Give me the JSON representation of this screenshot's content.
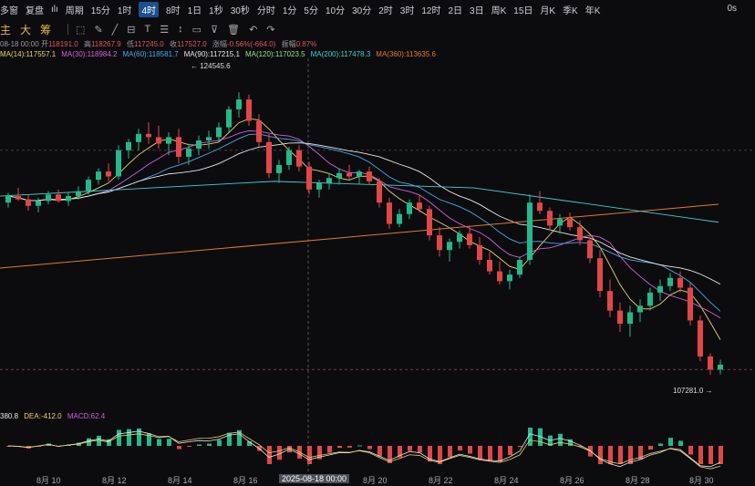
{
  "topbar": {
    "items": [
      "多窗",
      "复盘",
      "15分",
      "1时",
      "4时",
      "8时",
      "1日",
      "1秒",
      "30秒",
      "分时",
      "1分",
      "5分",
      "10分",
      "30分",
      "2时",
      "3时",
      "12时",
      "2日",
      "3日",
      "周K",
      "15日",
      "月K",
      "季K",
      "年K"
    ],
    "period_label": "周期",
    "active": "4时",
    "right": "0s"
  },
  "toolbar": {
    "tabs": [
      "主",
      "大",
      "筹"
    ]
  },
  "ohlc": {
    "time": "08-18 00:00",
    "open_label": "开",
    "open": "118191.0",
    "high_label": "高",
    "high": "118267.9",
    "low_label": "低",
    "low": "117245.0",
    "close_label": "收",
    "close": "117527.0",
    "chg_label": "涨幅",
    "chg": "-0.56%(-664.0)",
    "amp_label": "振幅",
    "amp": "0.87%"
  },
  "ma": [
    {
      "label": "MA(14):117557.1",
      "color": "#e8d26a"
    },
    {
      "label": "MA(30):118984.2",
      "color": "#d55fd8"
    },
    {
      "label": "MA(60):118581.7",
      "color": "#4aa8e8"
    },
    {
      "label": "MA(90):117215.1",
      "color": "#e8e8e8"
    },
    {
      "label": "MA(120):117023.5",
      "color": "#9be08a"
    },
    {
      "label": "MA(200):117478.3",
      "color": "#40d0d0"
    },
    {
      "label": "MA(360):113635.6",
      "color": "#e07a30"
    }
  ],
  "macd": {
    "dif": "380.8",
    "dea_label": "DEA:-412.0",
    "macd_label": "MACD:62.4",
    "colors": {
      "dif": "#e8e8e8",
      "dea": "#e8d26a",
      "macd": "#d55fd8"
    }
  },
  "annotations": {
    "high": "← 124545.6",
    "low": "107281.0 →"
  },
  "xaxis": {
    "ticks": [
      "8月 10",
      "8月 12",
      "8月 14",
      "8月 16",
      "2025-08-18 00:00",
      "8月 20",
      "8月 22",
      "8月 24",
      "8月 26",
      "8月 28",
      "8月 30"
    ]
  },
  "colors": {
    "up": "#26b88a",
    "down": "#e04848",
    "bg": "#0c0c0f"
  },
  "chart_data": {
    "type": "candlestick",
    "price_range": [
      106000,
      125500
    ],
    "candles": [
      [
        117800,
        118400,
        117500,
        118200
      ],
      [
        118200,
        118700,
        117900,
        118000
      ],
      [
        118000,
        118300,
        117300,
        117600
      ],
      [
        117600,
        118100,
        117200,
        117900
      ],
      [
        117900,
        118500,
        117700,
        118300
      ],
      [
        118300,
        118600,
        117800,
        117900
      ],
      [
        117900,
        118400,
        117600,
        118200
      ],
      [
        118200,
        118800,
        118000,
        118500
      ],
      [
        118500,
        119400,
        118300,
        119200
      ],
      [
        119200,
        119900,
        118900,
        119700
      ],
      [
        119700,
        120200,
        119100,
        119400
      ],
      [
        119400,
        121300,
        119200,
        121000
      ],
      [
        121000,
        121700,
        120500,
        121500
      ],
      [
        121500,
        122300,
        121000,
        122000
      ],
      [
        122000,
        122700,
        121400,
        121800
      ],
      [
        121800,
        122500,
        121100,
        121400
      ],
      [
        121400,
        122100,
        120700,
        121800
      ],
      [
        121800,
        122300,
        120200,
        120600
      ],
      [
        120600,
        121400,
        120100,
        121100
      ],
      [
        121100,
        121900,
        120700,
        121600
      ],
      [
        121600,
        122200,
        121100,
        121800
      ],
      [
        121800,
        122700,
        121500,
        122400
      ],
      [
        122400,
        123700,
        122100,
        123500
      ],
      [
        123500,
        124545,
        123000,
        124100
      ],
      [
        124100,
        124400,
        122500,
        122800
      ],
      [
        122800,
        123200,
        121200,
        121500
      ],
      [
        121500,
        122000,
        119300,
        119600
      ],
      [
        119600,
        120400,
        119000,
        120100
      ],
      [
        120100,
        121200,
        119800,
        121000
      ],
      [
        121000,
        121300,
        119700,
        120000
      ],
      [
        120000,
        120300,
        118300,
        118600
      ],
      [
        118600,
        119200,
        118100,
        119000
      ],
      [
        119000,
        119600,
        118600,
        119300
      ],
      [
        119300,
        119900,
        118900,
        119600
      ],
      [
        119600,
        120100,
        119200,
        119400
      ],
      [
        119400,
        119800,
        118900,
        119700
      ],
      [
        119700,
        120000,
        118900,
        119100
      ],
      [
        119100,
        119300,
        117500,
        117800
      ],
      [
        117800,
        118100,
        116200,
        116500
      ],
      [
        116500,
        117400,
        116300,
        117100
      ],
      [
        117100,
        118000,
        116800,
        117800
      ],
      [
        117800,
        118300,
        117200,
        117400
      ],
      [
        117400,
        117600,
        115500,
        115800
      ],
      [
        115800,
        116300,
        114500,
        114900
      ],
      [
        114900,
        115600,
        114200,
        115400
      ],
      [
        115400,
        116100,
        115000,
        115900
      ],
      [
        115900,
        116400,
        115000,
        115200
      ],
      [
        115200,
        115700,
        114000,
        114300
      ],
      [
        114300,
        114800,
        113400,
        113600
      ],
      [
        113600,
        114200,
        112800,
        113000
      ],
      [
        113000,
        113700,
        112500,
        113400
      ],
      [
        113400,
        114500,
        113200,
        114300
      ],
      [
        114300,
        118300,
        114000,
        117800
      ],
      [
        117800,
        118500,
        117100,
        117300
      ],
      [
        117300,
        117500,
        116100,
        116400
      ],
      [
        116400,
        117100,
        115900,
        116800
      ],
      [
        116800,
        117200,
        116100,
        116300
      ],
      [
        116300,
        116700,
        115200,
        115500
      ],
      [
        115500,
        115800,
        114100,
        114400
      ],
      [
        114400,
        114900,
        112000,
        112400
      ],
      [
        112400,
        113100,
        110800,
        111200
      ],
      [
        111200,
        111700,
        109900,
        110400
      ],
      [
        110400,
        111500,
        109600,
        111100
      ],
      [
        111100,
        111900,
        110500,
        111500
      ],
      [
        111500,
        112600,
        111200,
        112300
      ],
      [
        112300,
        113100,
        111800,
        112700
      ],
      [
        112700,
        113500,
        112400,
        113200
      ],
      [
        113200,
        113600,
        112300,
        112600
      ],
      [
        112600,
        112900,
        110300,
        110600
      ],
      [
        110600,
        110900,
        108100,
        108400
      ],
      [
        108400,
        108600,
        107281,
        107600
      ],
      [
        107600,
        108200,
        107300,
        107900
      ]
    ]
  }
}
